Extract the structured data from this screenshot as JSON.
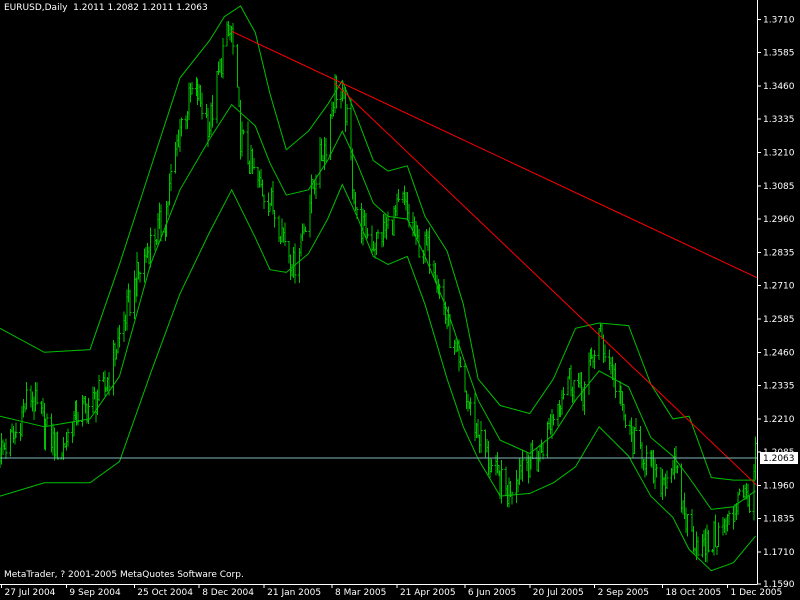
{
  "window": {
    "symbol_line": "EURUSD,Daily",
    "ohlc_line": "1.2011 1.2082 1.2011 1.2063",
    "copyright": "MetaTrader, ? 2001-2005 MetaQuotes Software Corp."
  },
  "colors": {
    "background": "#000000",
    "bars": "#00c000",
    "bands": "#00c000",
    "trendline": "#ff0000",
    "price_line": "#7fb7b7",
    "price_label_bg": "#ffffff",
    "price_label_text": "#000000",
    "axis": "#ffffff"
  },
  "chart_data": {
    "type": "ohlc",
    "symbol": "EURUSD",
    "timeframe": "Daily",
    "current_price": 1.2063,
    "current_price_label": "1.2063",
    "ylim": [
      1.159,
      1.376
    ],
    "y_tick_labels": [
      "1.3710",
      "1.3585",
      "1.3460",
      "1.3335",
      "1.3210",
      "1.3085",
      "1.2960",
      "1.2835",
      "1.2710",
      "1.2585",
      "1.2460",
      "1.2335",
      "1.2210",
      "1.2085",
      "1.1960",
      "1.1835",
      "1.1710",
      "1.1590"
    ],
    "y_ticks": [
      1.371,
      1.3585,
      1.346,
      1.3335,
      1.321,
      1.3085,
      1.296,
      1.2835,
      1.271,
      1.2585,
      1.246,
      1.2335,
      1.221,
      1.2085,
      1.196,
      1.1835,
      1.171,
      1.159
    ],
    "x_tick_labels": [
      "27 Jul 2004",
      "9 Sep 2004",
      "25 Oct 2004",
      "8 Dec 2004",
      "21 Jan 2005",
      "8 Mar 2005",
      "21 Apr 2005",
      "6 Jun 2005",
      "20 Jul 2005",
      "2 Sep 2005",
      "18 Oct 2005",
      "1 Dec 2005"
    ],
    "x_ticks": [
      "2004-07-27",
      "2004-09-09",
      "2004-10-25",
      "2004-12-08",
      "2005-01-21",
      "2005-03-08",
      "2005-04-21",
      "2005-06-06",
      "2005-07-20",
      "2005-09-02",
      "2005-10-18",
      "2005-12-01"
    ],
    "xlim": [
      "2004-07-26",
      "2005-12-21"
    ],
    "close_path": [
      [
        "2004-07-26",
        1.209
      ],
      [
        "2004-08-05",
        1.214
      ],
      [
        "2004-08-15",
        1.231
      ],
      [
        "2004-08-25",
        1.218
      ],
      [
        "2004-09-05",
        1.208
      ],
      [
        "2004-09-15",
        1.222
      ],
      [
        "2004-09-25",
        1.226
      ],
      [
        "2004-10-05",
        1.232
      ],
      [
        "2004-10-15",
        1.252
      ],
      [
        "2004-10-25",
        1.271
      ],
      [
        "2004-11-05",
        1.287
      ],
      [
        "2004-11-15",
        1.297
      ],
      [
        "2004-11-25",
        1.331
      ],
      [
        "2004-12-05",
        1.346
      ],
      [
        "2004-12-15",
        1.331
      ],
      [
        "2004-12-25",
        1.362
      ],
      [
        "2004-12-30",
        1.366
      ],
      [
        "2005-01-05",
        1.327
      ],
      [
        "2005-01-15",
        1.311
      ],
      [
        "2005-01-25",
        1.303
      ],
      [
        "2005-02-05",
        1.288
      ],
      [
        "2005-02-10",
        1.278
      ],
      [
        "2005-02-15",
        1.289
      ],
      [
        "2005-02-25",
        1.313
      ],
      [
        "2005-03-05",
        1.327
      ],
      [
        "2005-03-10",
        1.346
      ],
      [
        "2005-03-17",
        1.337
      ],
      [
        "2005-03-25",
        1.296
      ],
      [
        "2005-04-05",
        1.287
      ],
      [
        "2005-04-15",
        1.293
      ],
      [
        "2005-04-25",
        1.302
      ],
      [
        "2005-05-05",
        1.287
      ],
      [
        "2005-05-15",
        1.283
      ],
      [
        "2005-05-25",
        1.257
      ],
      [
        "2005-06-05",
        1.232
      ],
      [
        "2005-06-15",
        1.216
      ],
      [
        "2005-06-25",
        1.201
      ],
      [
        "2005-07-05",
        1.193
      ],
      [
        "2005-07-15",
        1.206
      ],
      [
        "2005-07-25",
        1.205
      ],
      [
        "2005-08-05",
        1.223
      ],
      [
        "2005-08-15",
        1.237
      ],
      [
        "2005-08-25",
        1.231
      ],
      [
        "2005-09-05",
        1.253
      ],
      [
        "2005-09-10",
        1.246
      ],
      [
        "2005-09-15",
        1.237
      ],
      [
        "2005-09-25",
        1.215
      ],
      [
        "2005-10-05",
        1.208
      ],
      [
        "2005-10-15",
        1.196
      ],
      [
        "2005-10-25",
        1.204
      ],
      [
        "2005-11-05",
        1.179
      ],
      [
        "2005-11-15",
        1.172
      ],
      [
        "2005-11-25",
        1.178
      ],
      [
        "2005-12-05",
        1.184
      ],
      [
        "2005-12-10",
        1.199
      ],
      [
        "2005-12-15",
        1.188
      ],
      [
        "2005-12-20",
        1.206
      ]
    ],
    "bands": {
      "upper": [
        [
          "2004-07-26",
          1.255
        ],
        [
          "2004-08-25",
          1.246
        ],
        [
          "2004-09-25",
          1.247
        ],
        [
          "2004-10-15",
          1.279
        ],
        [
          "2004-11-05",
          1.315
        ],
        [
          "2004-11-25",
          1.349
        ],
        [
          "2004-12-15",
          1.363
        ],
        [
          "2004-12-25",
          1.372
        ],
        [
          "2005-01-05",
          1.376
        ],
        [
          "2005-01-15",
          1.366
        ],
        [
          "2005-01-25",
          1.343
        ],
        [
          "2005-02-05",
          1.322
        ],
        [
          "2005-02-20",
          1.329
        ],
        [
          "2005-03-05",
          1.339
        ],
        [
          "2005-03-15",
          1.348
        ],
        [
          "2005-03-25",
          1.334
        ],
        [
          "2005-04-05",
          1.318
        ],
        [
          "2005-04-15",
          1.314
        ],
        [
          "2005-04-28",
          1.316
        ],
        [
          "2005-05-10",
          1.297
        ],
        [
          "2005-05-25",
          1.284
        ],
        [
          "2005-06-05",
          1.264
        ],
        [
          "2005-06-15",
          1.236
        ],
        [
          "2005-06-30",
          1.226
        ],
        [
          "2005-07-20",
          1.223
        ],
        [
          "2005-08-05",
          1.236
        ],
        [
          "2005-08-20",
          1.255
        ],
        [
          "2005-09-05",
          1.257
        ],
        [
          "2005-09-25",
          1.256
        ],
        [
          "2005-10-10",
          1.234
        ],
        [
          "2005-10-25",
          1.221
        ],
        [
          "2005-11-05",
          1.222
        ],
        [
          "2005-11-20",
          1.199
        ],
        [
          "2005-12-05",
          1.198
        ],
        [
          "2005-12-20",
          1.198
        ]
      ],
      "middle": [
        [
          "2004-07-26",
          1.222
        ],
        [
          "2004-08-25",
          1.218
        ],
        [
          "2004-09-25",
          1.221
        ],
        [
          "2004-10-15",
          1.237
        ],
        [
          "2004-11-05",
          1.279
        ],
        [
          "2004-11-25",
          1.307
        ],
        [
          "2004-12-15",
          1.326
        ],
        [
          "2004-12-30",
          1.339
        ],
        [
          "2005-01-15",
          1.331
        ],
        [
          "2005-01-25",
          1.317
        ],
        [
          "2005-02-05",
          1.305
        ],
        [
          "2005-02-20",
          1.307
        ],
        [
          "2005-03-05",
          1.318
        ],
        [
          "2005-03-15",
          1.329
        ],
        [
          "2005-03-25",
          1.317
        ],
        [
          "2005-04-05",
          1.302
        ],
        [
          "2005-04-15",
          1.297
        ],
        [
          "2005-04-28",
          1.296
        ],
        [
          "2005-05-10",
          1.282
        ],
        [
          "2005-05-25",
          1.262
        ],
        [
          "2005-06-05",
          1.244
        ],
        [
          "2005-06-15",
          1.228
        ],
        [
          "2005-06-30",
          1.213
        ],
        [
          "2005-07-20",
          1.208
        ],
        [
          "2005-08-05",
          1.215
        ],
        [
          "2005-08-20",
          1.228
        ],
        [
          "2005-09-05",
          1.239
        ],
        [
          "2005-09-25",
          1.233
        ],
        [
          "2005-10-10",
          1.214
        ],
        [
          "2005-10-25",
          1.207
        ],
        [
          "2005-11-05",
          1.199
        ],
        [
          "2005-11-20",
          1.187
        ],
        [
          "2005-12-05",
          1.188
        ],
        [
          "2005-12-20",
          1.194
        ]
      ],
      "lower": [
        [
          "2004-07-26",
          1.192
        ],
        [
          "2004-08-25",
          1.197
        ],
        [
          "2004-09-25",
          1.197
        ],
        [
          "2004-10-15",
          1.205
        ],
        [
          "2004-11-05",
          1.238
        ],
        [
          "2004-11-25",
          1.268
        ],
        [
          "2004-12-15",
          1.291
        ],
        [
          "2004-12-30",
          1.307
        ],
        [
          "2005-01-15",
          1.289
        ],
        [
          "2005-01-25",
          1.277
        ],
        [
          "2005-02-05",
          1.276
        ],
        [
          "2005-02-20",
          1.283
        ],
        [
          "2005-03-05",
          1.296
        ],
        [
          "2005-03-15",
          1.309
        ],
        [
          "2005-03-25",
          1.297
        ],
        [
          "2005-04-05",
          1.282
        ],
        [
          "2005-04-15",
          1.279
        ],
        [
          "2005-04-28",
          1.282
        ],
        [
          "2005-05-10",
          1.264
        ],
        [
          "2005-05-25",
          1.236
        ],
        [
          "2005-06-05",
          1.218
        ],
        [
          "2005-06-15",
          1.206
        ],
        [
          "2005-06-30",
          1.192
        ],
        [
          "2005-07-20",
          1.193
        ],
        [
          "2005-08-05",
          1.197
        ],
        [
          "2005-08-20",
          1.203
        ],
        [
          "2005-09-05",
          1.218
        ],
        [
          "2005-09-25",
          1.207
        ],
        [
          "2005-10-10",
          1.192
        ],
        [
          "2005-10-25",
          1.184
        ],
        [
          "2005-11-05",
          1.172
        ],
        [
          "2005-11-20",
          1.164
        ],
        [
          "2005-12-05",
          1.167
        ],
        [
          "2005-12-20",
          1.177
        ]
      ]
    },
    "trendlines": [
      {
        "from": [
          "2004-12-30",
          1.3665
        ],
        "to": [
          "2005-12-21",
          1.274
        ]
      },
      {
        "from": [
          "2005-03-10",
          1.347
        ],
        "to": [
          "2005-12-21",
          1.196
        ]
      }
    ],
    "grid": false,
    "legend": "none"
  }
}
